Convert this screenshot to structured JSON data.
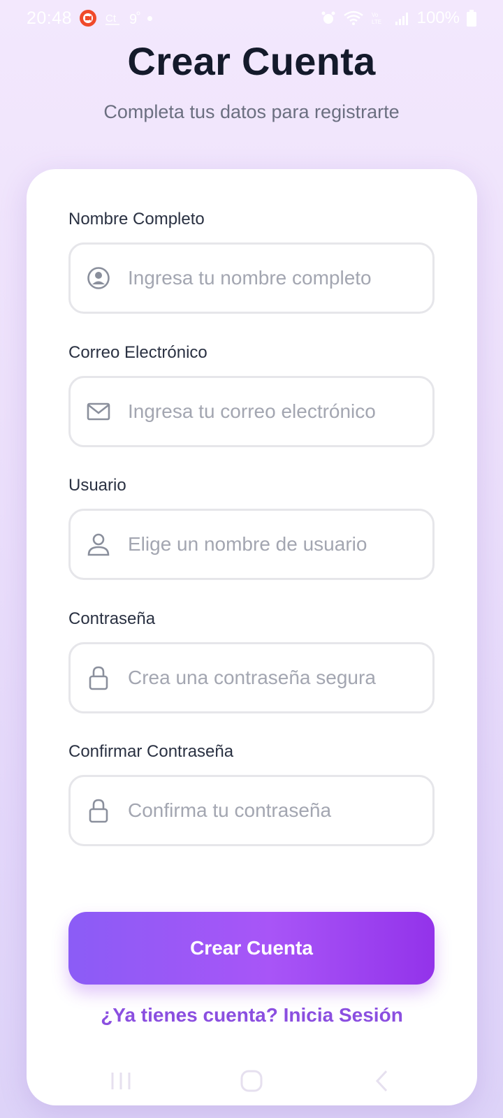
{
  "status_bar": {
    "time": "20:48",
    "battery": "100%",
    "icons": [
      "screen-recorder-icon",
      "carrier-icon",
      "temperature-icon",
      "notification-dot",
      "alarm-icon",
      "wifi-icon",
      "volte-icon",
      "signal-icon",
      "battery-icon"
    ]
  },
  "header": {
    "title": "Crear Cuenta",
    "subtitle": "Completa tus datos para registrarte"
  },
  "form": {
    "fields": [
      {
        "label": "Nombre Completo",
        "placeholder": "Ingresa tu nombre completo",
        "icon": "account-circle-icon",
        "value": ""
      },
      {
        "label": "Correo Electrónico",
        "placeholder": "Ingresa tu correo electrónico",
        "icon": "mail-icon",
        "value": ""
      },
      {
        "label": "Usuario",
        "placeholder": "Elige un nombre de usuario",
        "icon": "user-icon",
        "value": ""
      },
      {
        "label": "Contraseña",
        "placeholder": "Crea una contraseña segura",
        "icon": "lock-icon",
        "value": ""
      },
      {
        "label": "Confirmar Contraseña",
        "placeholder": "Confirma tu contraseña",
        "icon": "lock-icon",
        "value": ""
      }
    ],
    "submit_label": "Crear Cuenta",
    "login_link": "¿Ya tienes cuenta? Inicia Sesión"
  },
  "colors": {
    "accent_start": "#8b5cf6",
    "accent_end": "#9333ea",
    "link": "#8b4fe0",
    "title": "#141a2b"
  },
  "nav_bar": {
    "icons": [
      "recents-icon",
      "home-icon",
      "back-icon"
    ]
  }
}
